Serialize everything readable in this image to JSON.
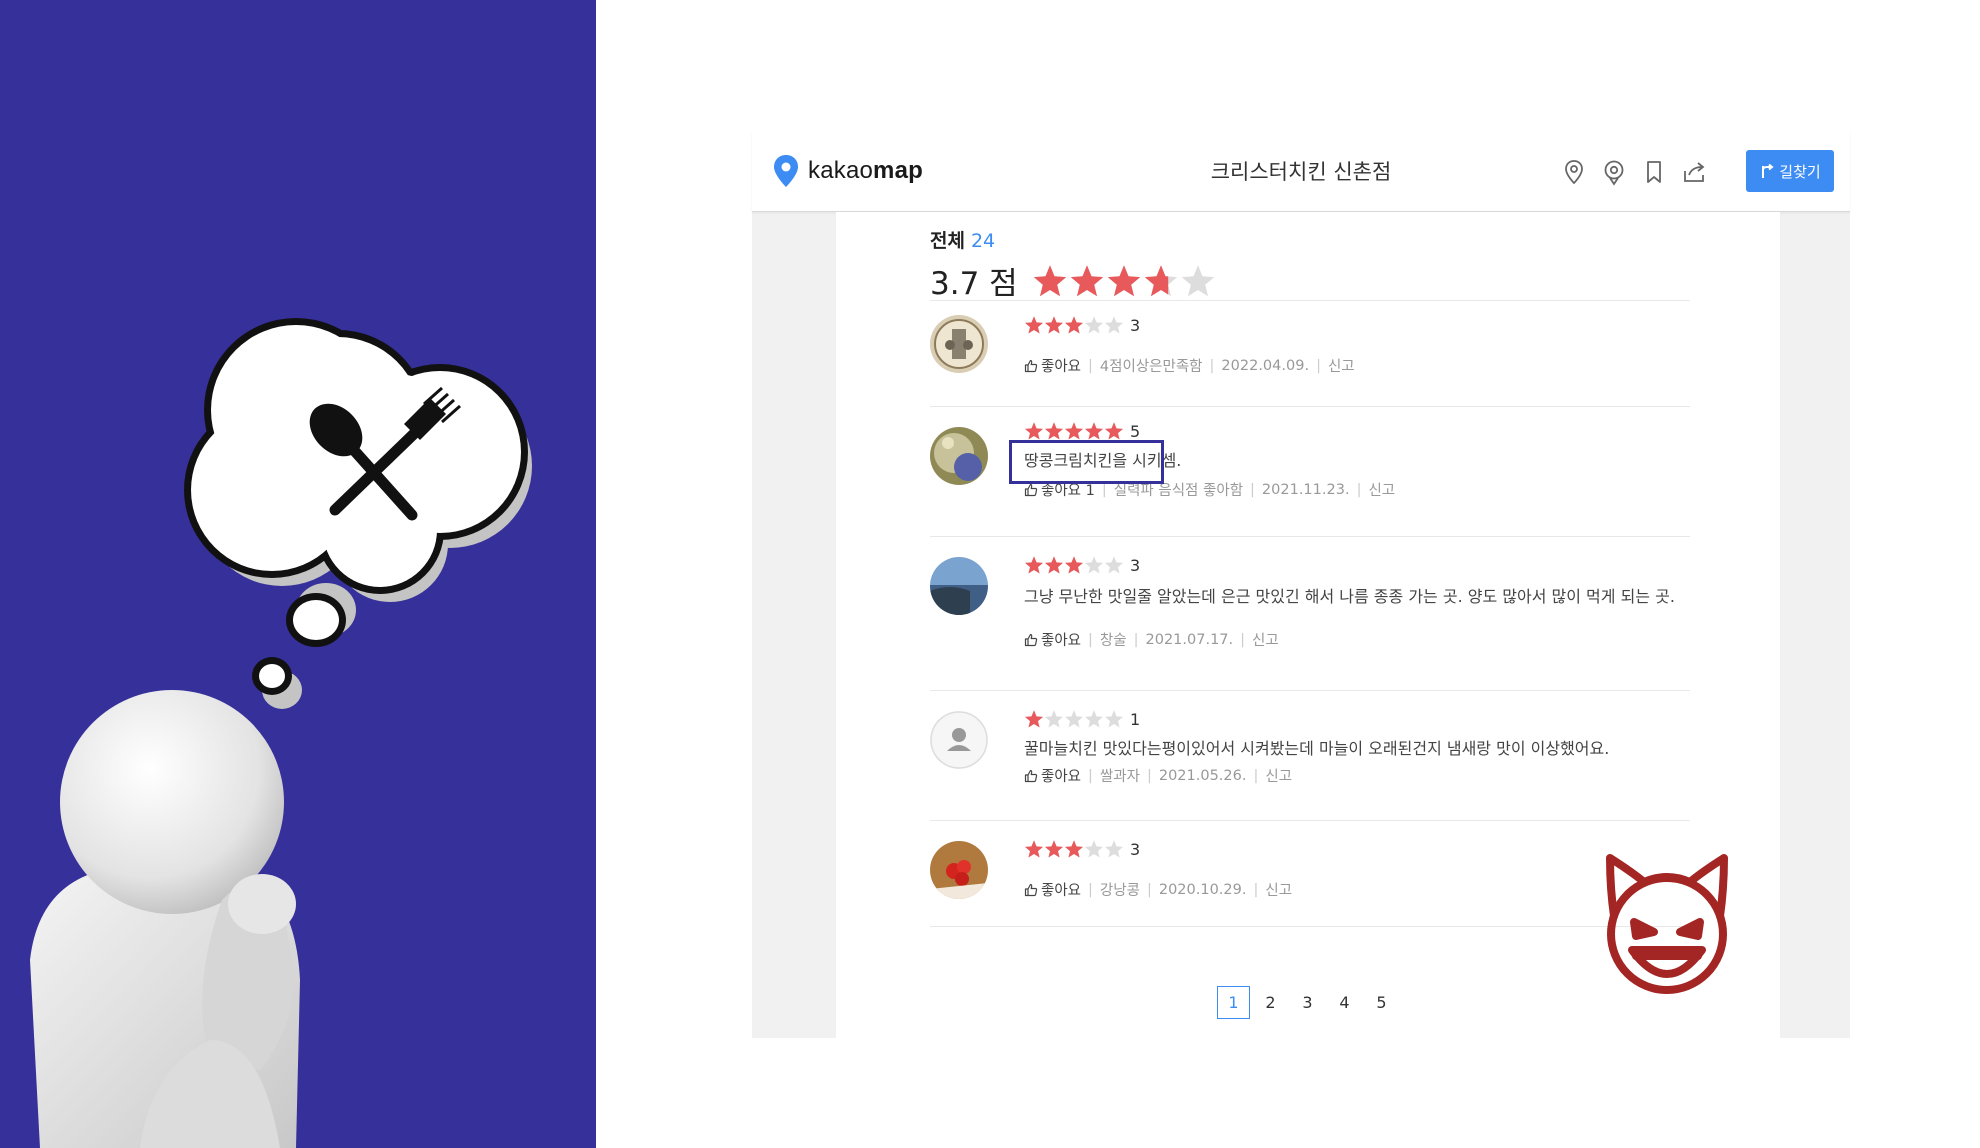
{
  "header": {
    "logo": {
      "prefix": "kakao",
      "suffix": "map"
    },
    "place_title": "크리스터치킨 신촌점",
    "icons": [
      "map-pin-icon",
      "location-icon",
      "bookmark-icon",
      "share-icon"
    ],
    "route_button_label": "길찾기"
  },
  "summary": {
    "heading": "전체",
    "count": "24",
    "score_text": "3.7 점",
    "rating": 3.7
  },
  "reviews": [
    {
      "rating": 3,
      "rating_text": "3",
      "text": "",
      "like_label": "좋아요",
      "author": "4점이상은만족함",
      "date": "2022.04.09.",
      "report_label": "신고"
    },
    {
      "rating": 5,
      "rating_text": "5",
      "text": "땅콩크림치킨을 시키셈.",
      "like_label": "좋아요 1",
      "author": "실력파 음식점 좋아함",
      "date": "2021.11.23.",
      "report_label": "신고"
    },
    {
      "rating": 3,
      "rating_text": "3",
      "text": "그냥 무난한 맛일줄 알았는데 은근 맛있긴 해서 나름 종종 가는 곳. 양도 많아서 많이 먹게 되는 곳.",
      "like_label": "좋아요",
      "author": "창술",
      "date": "2021.07.17.",
      "report_label": "신고"
    },
    {
      "rating": 1,
      "rating_text": "1",
      "text": "꿀마늘치킨 맛있다는평이있어서 시켜봤는데 마늘이 오래된건지 냄새랑 맛이 이상했어요.",
      "like_label": "좋아요",
      "author": "쌀과자",
      "date": "2021.05.26.",
      "report_label": "신고"
    },
    {
      "rating": 3,
      "rating_text": "3",
      "text": "",
      "like_label": "좋아요",
      "author": "강낭콩",
      "date": "2020.10.29.",
      "report_label": "신고"
    }
  ],
  "pagination": {
    "pages": [
      "1",
      "2",
      "3",
      "4",
      "5"
    ],
    "active": "1"
  },
  "colors": {
    "background_panel": "#36309a",
    "star": "#e8595b",
    "accent": "#3c8cf4",
    "devil": "#a32625",
    "highlight": "#36309a"
  },
  "decor": {
    "left_illustration": [
      "thinking-person-figure",
      "thought-bubble",
      "fork-spoon-icon"
    ],
    "emoji": "devil-face-icon"
  }
}
